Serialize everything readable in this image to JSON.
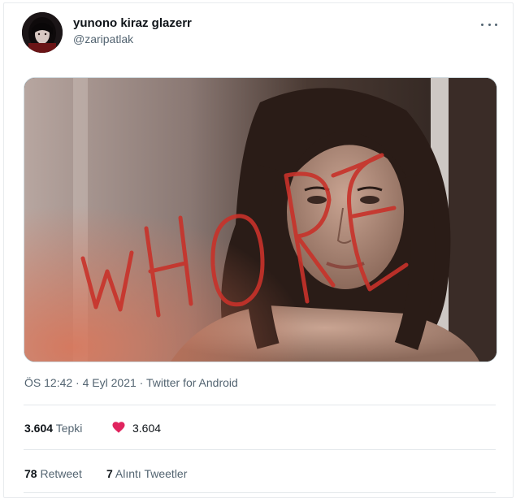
{
  "tweet": {
    "display_name": "yunono kiraz glazerr",
    "handle": "@zaripatlak",
    "more_icon": "more-horizontal-icon",
    "media": {
      "overlay_text": "WHORE",
      "overlay_color": "#c8322a"
    },
    "time": "ÖS 12:42",
    "sep1": "·",
    "date": "4 Eyl 2021",
    "sep2": "·",
    "source": "Twitter for Android"
  },
  "stats": {
    "reactions_count": "3.604",
    "reactions_label": "Tepki",
    "heart_icon": "heart-icon",
    "heart_color": "#f91880",
    "likes_count": "3.604",
    "retweets_count": "78",
    "retweets_label": "Retweet",
    "quotes_count": "7",
    "quotes_label": "Alıntı Tweetler"
  }
}
